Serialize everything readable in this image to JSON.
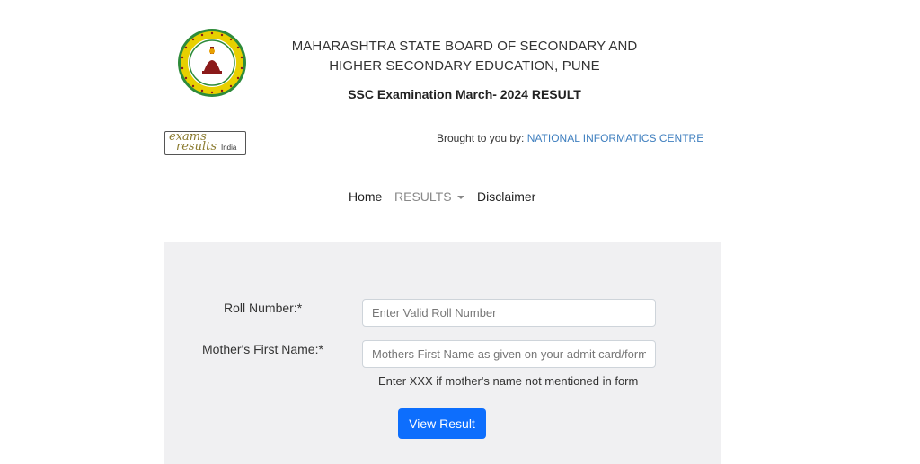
{
  "header": {
    "board_line1": "MAHARASHTRA STATE BOARD OF SECONDARY AND",
    "board_line2": "HIGHER SECONDARY EDUCATION, PUNE",
    "exam_title": "SSC Examination March- 2024 RESULT",
    "emblem_icon": "board-emblem-icon"
  },
  "partner": {
    "logo_word1": "exams",
    "logo_word2": "results",
    "logo_word3": "India",
    "brought_prefix": "Brought to you by:",
    "brought_name": "NATIONAL INFORMATICS CENTRE"
  },
  "nav": {
    "home": "Home",
    "results": "RESULTS",
    "disclaimer": "Disclaimer"
  },
  "form": {
    "roll_label": "Roll Number:*",
    "roll_placeholder": "Enter Valid Roll Number",
    "roll_value": "",
    "mother_label": "Mother's First Name:*",
    "mother_placeholder": "Mothers First Name as given on your admit card/form",
    "mother_value": "",
    "mother_hint": "Enter XXX if mother's name not mentioned in form",
    "submit_label": "View Result"
  },
  "colors": {
    "button": "#0d6efd",
    "panel": "#f0f0f2",
    "link": "#3f7fbf",
    "emblem_green": "#2e8b3a",
    "emblem_yellow": "#e8d000"
  }
}
